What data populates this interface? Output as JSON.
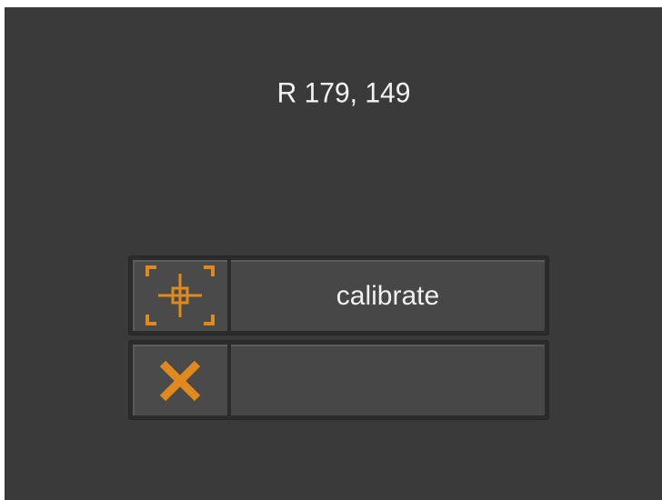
{
  "status": {
    "coordinate_readout": "R 179, 149"
  },
  "menu": {
    "items": [
      {
        "icon": "crosshair-target-icon",
        "label": "calibrate"
      },
      {
        "icon": "close-x-icon",
        "label": ""
      }
    ]
  },
  "colors": {
    "background": "#3a3a3a",
    "button_face": "#474747",
    "accent_orange": "#e08a1e",
    "text": "#f0f0f0"
  }
}
